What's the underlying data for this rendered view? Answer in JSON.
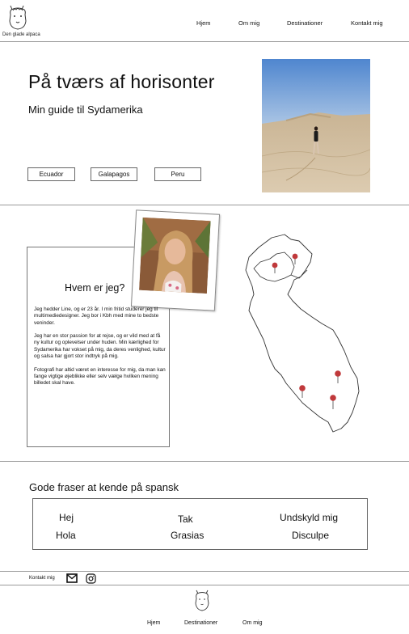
{
  "header": {
    "logo_text": "Den glade alpaca",
    "nav": [
      "Hjem",
      "Om mig",
      "Destinationer",
      "Kontakt mig"
    ]
  },
  "hero": {
    "title": "På tværs af horisonter",
    "subtitle": "Min guide til Sydamerika",
    "buttons": [
      "Ecuador",
      "Galapagos",
      "Peru"
    ]
  },
  "about": {
    "title": "Hvem er jeg?",
    "paragraphs": [
      "Jeg hedder Line, og er 23 år. I min fritid studerer jeg til multimediedesigner. Jeg bor i Kbh med mine to bedste veninder.",
      "Jeg har en stor passion for at rejse, og er vild med at få ny kultur og oplevelser under huden. Min kærlighed for Sydamerika har vokset på mig, da deres venlighed, kultur og salsa har gjort stor indtryk på mig.",
      "Fotografi har altid været en interesse for mig, da man kan fange vigtige øjeblikke eller selv vælge hvilken mening billedet skal have."
    ]
  },
  "phrases": {
    "title": "Gode fraser at kende på spansk",
    "items": [
      {
        "da": "Hej",
        "es": "Hola"
      },
      {
        "da": "Tak",
        "es": "Grasias"
      },
      {
        "da": "Undskyld mig",
        "es": "Disculpe"
      }
    ]
  },
  "contact": {
    "label": "Kontakt mig",
    "icons": [
      "mail-icon",
      "instagram-icon"
    ]
  },
  "footer": {
    "nav": [
      "Hjem",
      "Destinationer",
      "Om mig"
    ]
  },
  "colors": {
    "pin": "#c0393b",
    "divider": "#9a9a9a",
    "sky": "#6f9fd6",
    "sand": "#d3bfa0"
  }
}
